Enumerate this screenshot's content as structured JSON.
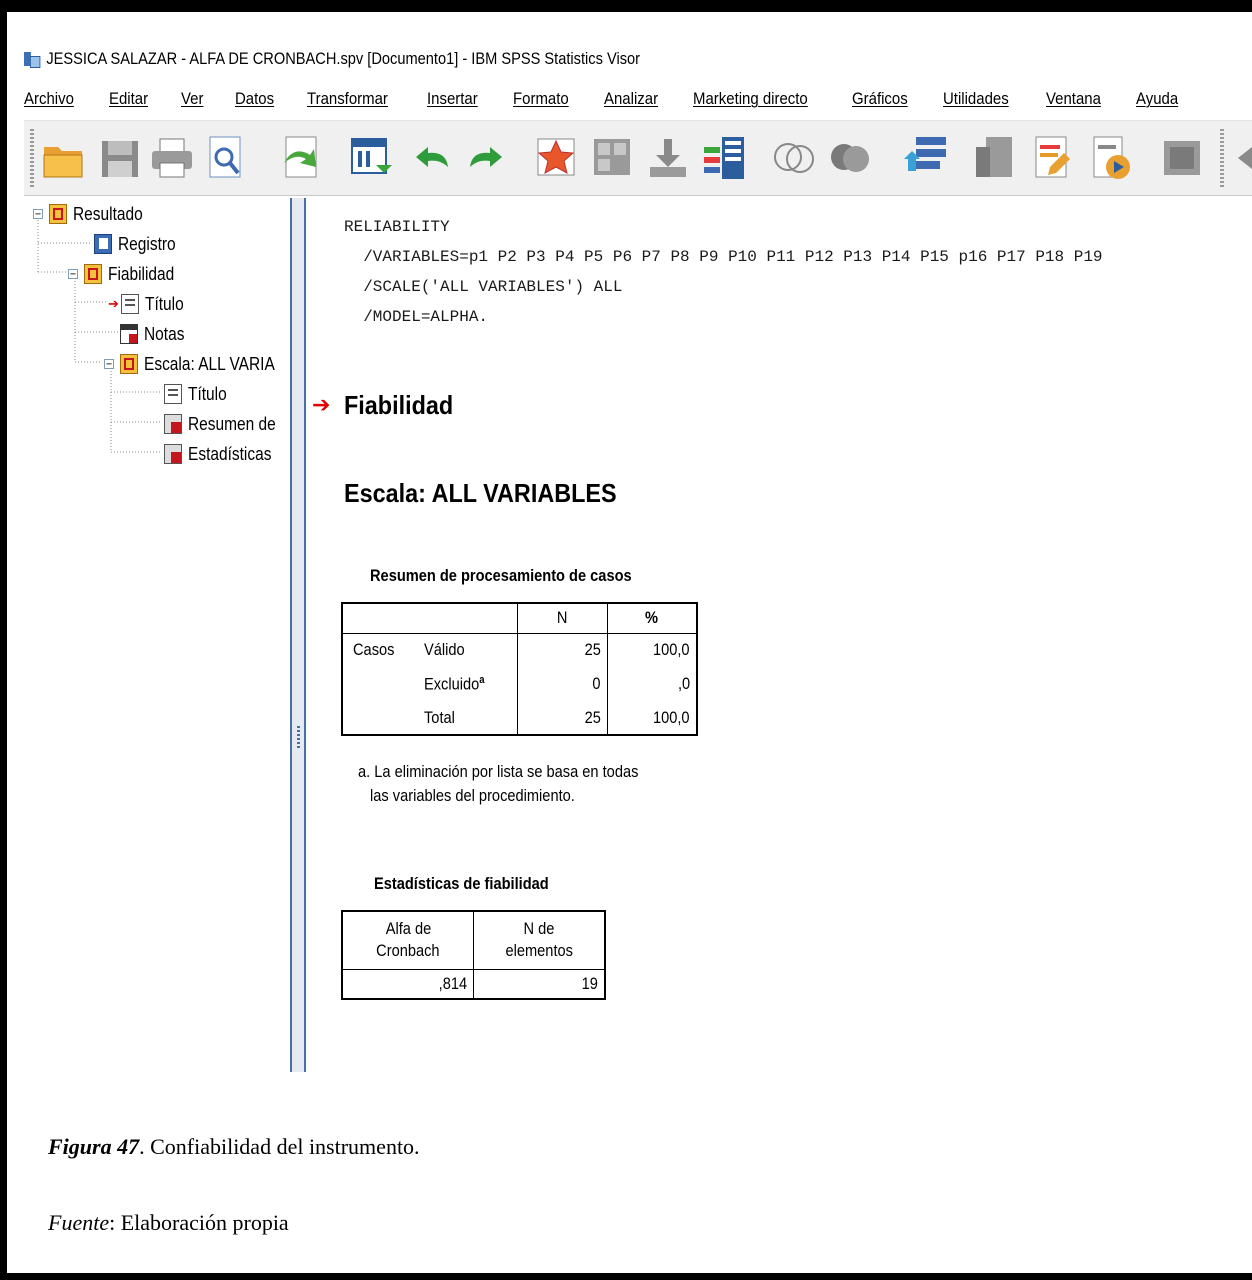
{
  "window": {
    "title": "JESSICA SALAZAR -  ALFA DE CRONBACH.spv [Documento1] - IBM SPSS Statistics Visor"
  },
  "menu": [
    "Archivo",
    "Editar",
    "Ver",
    "Datos",
    "Transformar",
    "Insertar",
    "Formato",
    "Analizar",
    "Marketing directo",
    "Gráficos",
    "Utilidades",
    "Ventana",
    "Ayuda"
  ],
  "toolbar": [
    "open-icon",
    "save-icon",
    "print-icon",
    "print-preview-icon",
    "export-icon",
    "goto-data-icon",
    "undo-icon",
    "redo-icon",
    "goto-case-icon",
    "goto-variable-icon",
    "variables-icon",
    "value-labels-icon",
    "use-sets-icon",
    "show-all-variables-icon",
    "spelling-icon",
    "designate-window-icon",
    "insert-output-icon",
    "insert-text-icon",
    "insert-script-icon",
    "collapse-icon"
  ],
  "tree": {
    "root": "Resultado",
    "log": "Registro",
    "reliability": "Fiabilidad",
    "title1": "Título",
    "notes": "Notas",
    "scale": "Escala: ALL VARIA",
    "title2": "Título",
    "summary": "Resumen de",
    "stats": "Estadísticas"
  },
  "syntax": {
    "line1": "RELIABILITY",
    "line2": "  /VARIABLES=p1 P2 P3 P4 P5 P6 P7 P8 P9 P10 P11 P12 P13 P14 P15 p16 P17 P18 P19",
    "line3": "  /SCALE('ALL VARIABLES') ALL",
    "line4": "  /MODEL=ALPHA."
  },
  "output": {
    "heading1": "Fiabilidad",
    "heading2": "Escala: ALL VARIABLES",
    "case_summary": {
      "title": "Resumen de procesamiento de casos",
      "col_n": "N",
      "col_pct": "%",
      "group": "Casos",
      "row1_label": "Válido",
      "row1_n": "25",
      "row1_pct": "100,0",
      "row2_label": "Excluido",
      "row2_sup": "a",
      "row2_n": "0",
      "row2_pct": ",0",
      "row3_label": "Total",
      "row3_n": "25",
      "row3_pct": "100,0",
      "footnote1": "a. La eliminación por lista se basa en todas",
      "footnote2": "las variables del procedimiento."
    },
    "reliability_stats": {
      "title": "Estadísticas de fiabilidad",
      "col1_line1": "Alfa de",
      "col1_line2": "Cronbach",
      "col2_line1": "N de",
      "col2_line2": "elementos",
      "alpha": ",814",
      "n_items": "19"
    }
  },
  "caption": {
    "figure_label": "Figura 47",
    "figure_text": ". Confiabilidad del instrumento.",
    "source_label": "Fuente",
    "source_text": ": Elaboración propia"
  }
}
